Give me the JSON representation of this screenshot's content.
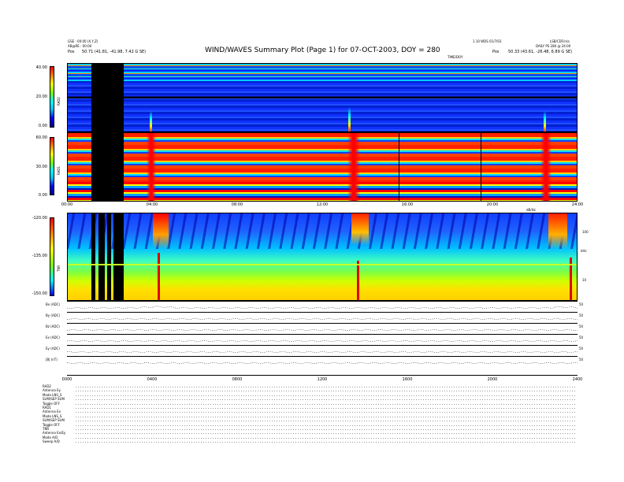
{
  "header": {
    "title": "WIND/WAVES Summary Plot (Page 1) for 07-OCT-2003, DOY = 280",
    "left_line1": "GSE : 00:00 (X,Y,Z)",
    "left_line2": "AB@RE : 00:00",
    "left_pos_label": "Pos",
    "left_pos_value": "50.71 (41.81, -41.98, 7.42 G SE)",
    "right_line1": "LSB/CDF/n/a",
    "right_line2": "1.10 WDS 01/7/03",
    "right_line3": "DAILY PS 280 @ 24:00",
    "right_pos_label": "Pos",
    "right_pos_value": "50.33 (43.61, -26.48, 6.89 G SE)",
    "top_mid_label": "TIME/DOY"
  },
  "rad2": {
    "name": "RAD2",
    "ticks": [
      "40.00",
      "20.00",
      "0.00"
    ]
  },
  "rad1": {
    "name": "RAD1",
    "ticks": [
      "60.00",
      "30.00",
      "0.00"
    ]
  },
  "tnr": {
    "name": "TNR",
    "ticks": [
      "-120.00",
      "-135.00",
      "-150.00"
    ],
    "right_ticks": [
      "100",
      "10"
    ],
    "right_unit": "kHz",
    "top_right_label": "dB/Hz"
  },
  "time_axis": {
    "labels": [
      "00:00",
      "04:00",
      "08:00",
      "12:00",
      "16:00",
      "20:00",
      "24:00"
    ]
  },
  "time_axis_bottom": {
    "labels": [
      "0000",
      "0400",
      "0800",
      "1200",
      "1600",
      "2000",
      "2400"
    ]
  },
  "time_plots": [
    {
      "label": "Bx (ADC)",
      "right": "50"
    },
    {
      "label": "By (ADC)",
      "right": "50"
    },
    {
      "label": "Bz (ADC)",
      "right": "50"
    },
    {
      "label": "Ex (ADC)",
      "right": "50"
    },
    {
      "label": "Ey (ADC)",
      "right": "50"
    },
    {
      "label": "|B| (nT)",
      "right": "50"
    }
  ],
  "info": {
    "lines": [
      "RAD2",
      "Antenna   Ey",
      "Mode    LNS_S",
      "SUM/SEP  SUM",
      "Toggle    OFF",
      "RAD1",
      "Antenna   Ex",
      "Mode   LNS_S",
      "SUM/SEP SUM",
      "Toggle    OFF",
      "TNR",
      "Antenna  Ex/Ey",
      "Mode     A/D",
      "Sweep    A/D"
    ]
  },
  "chart_data": {
    "type": "heatmap",
    "title": "WIND/WAVES Summary Plot (Page 1) for 07-OCT-2003, DOY = 280",
    "xlabel": "",
    "ylabel": "",
    "x": [
      "00:00",
      "04:00",
      "08:00",
      "12:00",
      "16:00",
      "20:00",
      "24:00"
    ],
    "panels": [
      "RAD2",
      "RAD1",
      "TNR"
    ]
  }
}
